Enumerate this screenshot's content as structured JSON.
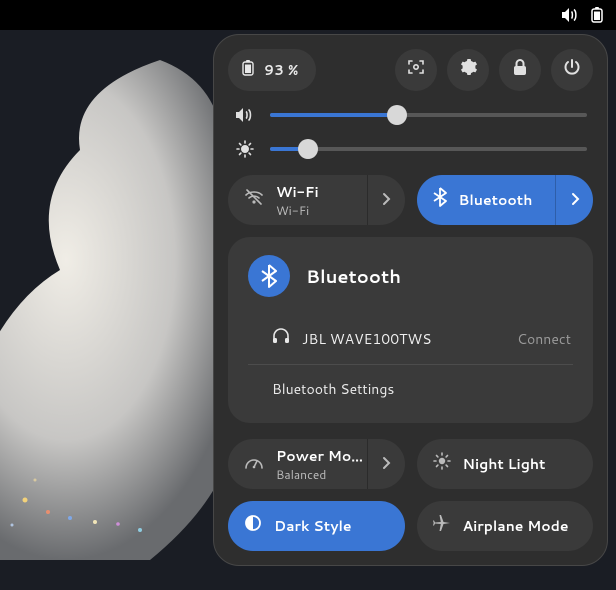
{
  "topbar": {
    "volume_icon": "volume-icon",
    "battery_icon": "battery-icon"
  },
  "header": {
    "battery_percent": "93 %"
  },
  "sliders": {
    "volume_pct": 40,
    "brightness_pct": 12
  },
  "wifi": {
    "title": "Wi-Fi",
    "subtitle": "Wi-Fi",
    "active": false
  },
  "bluetooth": {
    "title": "Bluetooth",
    "active": true
  },
  "bt_panel": {
    "title": "Bluetooth",
    "device_name": "JBL WAVE100TWS",
    "device_action": "Connect",
    "settings_label": "Bluetooth Settings"
  },
  "power": {
    "title": "Power Mo…",
    "subtitle": "Balanced",
    "active": false
  },
  "nightlight": {
    "title": "Night Light",
    "active": false
  },
  "darkstyle": {
    "title": "Dark Style",
    "active": true
  },
  "airplane": {
    "title": "Airplane Mode",
    "active": false
  },
  "colors": {
    "accent": "#3a76d4"
  }
}
